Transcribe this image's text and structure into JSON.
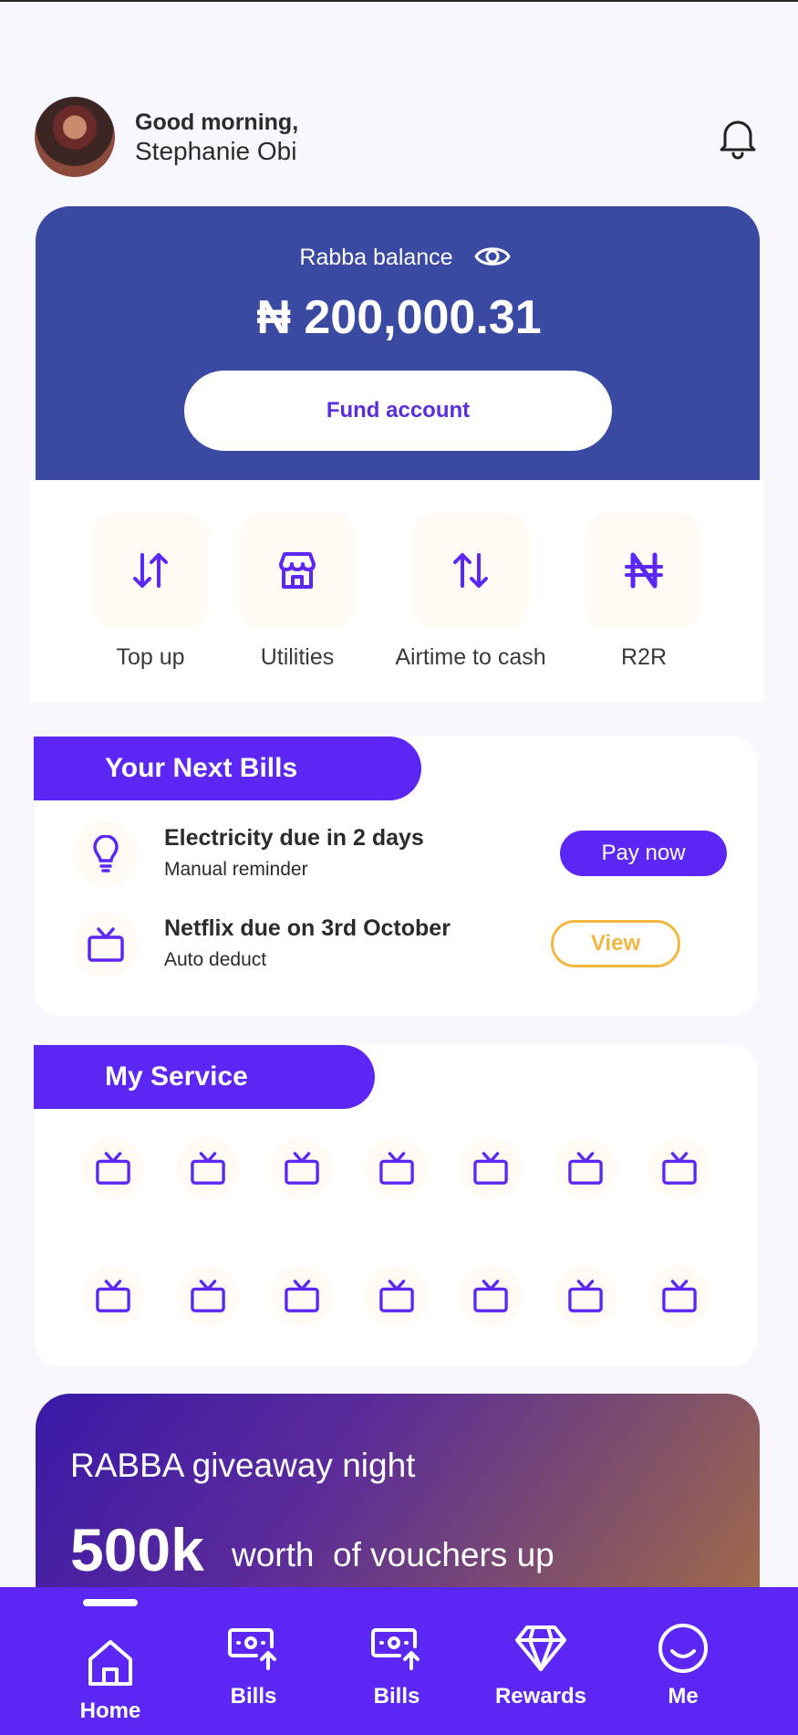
{
  "header": {
    "greeting": "Good morning,",
    "name": "Stephanie Obi",
    "avatar_icon": "user-avatar",
    "notification_icon": "bell-icon"
  },
  "balance": {
    "label": "Rabba balance",
    "amount": "₦ 200,000.31",
    "fund_button": "Fund account",
    "toggle_icon": "eye-icon"
  },
  "quick_actions": [
    {
      "label": "Top up",
      "icon": "arrows-up-down-icon"
    },
    {
      "label": "Utilities",
      "icon": "store-icon"
    },
    {
      "label": "Airtime to cash",
      "icon": "swap-vertical-icon"
    },
    {
      "label": "R2R",
      "icon": "naira-icon"
    }
  ],
  "next_bills": {
    "title": "Your Next Bills",
    "items": [
      {
        "title": "Electricity due in 2 days",
        "subtitle": "Manual reminder",
        "action": "Pay now",
        "icon": "lightbulb-icon"
      },
      {
        "title": "Netflix due on 3rd October",
        "subtitle": "Auto deduct",
        "action": "View",
        "icon": "tv-icon"
      }
    ]
  },
  "my_service": {
    "title": "My Service",
    "icon": "tv-icon",
    "count": 14
  },
  "promo": {
    "title": "RABBA giveaway night",
    "highlight": "500k",
    "rest": "worth  of vouchers up"
  },
  "nav": {
    "items": [
      {
        "label": "Home",
        "icon": "home-icon",
        "active": true
      },
      {
        "label": "Bills",
        "icon": "bills-icon",
        "active": false
      },
      {
        "label": "Bills",
        "icon": "bills-icon",
        "active": false
      },
      {
        "label": "Rewards",
        "icon": "diamond-icon",
        "active": false
      },
      {
        "label": "Me",
        "icon": "smiley-icon",
        "active": false
      }
    ]
  },
  "colors": {
    "primary": "#5c27f5",
    "balance_card": "#3a4aa3",
    "accent_yellow": "#f1b740",
    "background": "#f8f7fd"
  }
}
